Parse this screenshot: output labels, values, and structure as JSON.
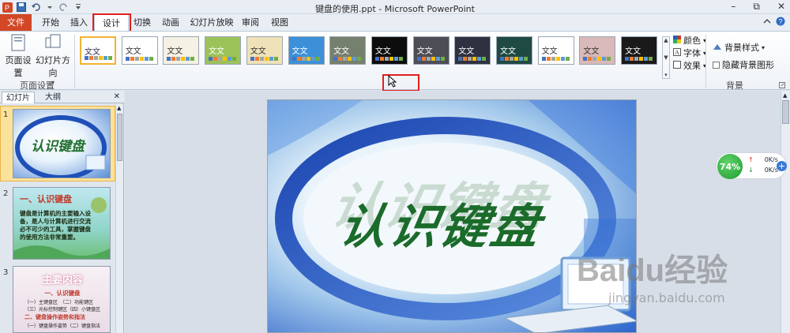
{
  "window": {
    "title": "键盘的使用.ppt - Microsoft PowerPoint",
    "minimize": "–",
    "restore": "⧉",
    "close": "✕"
  },
  "tabs": [
    {
      "label": "文件"
    },
    {
      "label": "开始"
    },
    {
      "label": "插入"
    },
    {
      "label": "设计"
    },
    {
      "label": "切换"
    },
    {
      "label": "动画"
    },
    {
      "label": "幻灯片放映"
    },
    {
      "label": "审阅"
    },
    {
      "label": "视图"
    }
  ],
  "ribbon": {
    "page_setup": {
      "label": "页面设置",
      "orientation": "幻灯片方向",
      "group": "页面设置"
    },
    "theme_sample": "文文",
    "themes": [
      {
        "bg": "#ffffff",
        "fg": "#335"
      },
      {
        "bg": "#ffffff",
        "fg": "#333"
      },
      {
        "bg": "#f5f1e4",
        "fg": "#333"
      },
      {
        "bg": "#9cc25a",
        "fg": "#fff"
      },
      {
        "bg": "#f0e2b8",
        "fg": "#333"
      },
      {
        "bg": "#3c90d8",
        "fg": "#fff"
      },
      {
        "bg": "#76806e",
        "fg": "#fff"
      },
      {
        "bg": "#0d0d0d",
        "fg": "#fff"
      },
      {
        "bg": "#4d4d55",
        "fg": "#fff"
      },
      {
        "bg": "#2f3140",
        "fg": "#fff"
      },
      {
        "bg": "#1f4a44",
        "fg": "#fff"
      },
      {
        "bg": "#ffffff",
        "fg": "#333"
      },
      {
        "bg": "#d9b9b9",
        "fg": "#333"
      },
      {
        "bg": "#1a1a1a",
        "fg": "#fff"
      }
    ],
    "colors_label": "颜色",
    "fonts_label": "字体",
    "effects_label": "效果",
    "bg_styles_label": "背景样式",
    "hide_bg_label": "隐藏背景图形",
    "bg_group": "背景"
  },
  "left_pane": {
    "tab_slides": "幻灯片",
    "tab_outline": "大纲",
    "close": "✕",
    "slides": [
      {
        "num": "1",
        "title": "认识键盘"
      },
      {
        "num": "2",
        "title": "一、认识键盘",
        "body": "键盘是计算机的主要输入设备，是人与计算机进行交流必不可少的工具，掌握键盘的使用方法非常重要。"
      },
      {
        "num": "3",
        "title": "主要内容",
        "line1": "一、认识键盘",
        "line2": "（一）主键盘区　（二）功能键区",
        "line3": "（三）光标控制键区（四）小键盘区",
        "line4": "二、键盘操作姿势和指法",
        "line5": "（一）键盘操作姿势（二）键盘指法"
      }
    ]
  },
  "slide": {
    "title": "认识键盘"
  },
  "net_widget": {
    "percent": "74%",
    "up": "0K/s",
    "down": "0K/s"
  },
  "watermark": {
    "brand": "Baidu经验",
    "url": "jingyan.baidu.com"
  }
}
